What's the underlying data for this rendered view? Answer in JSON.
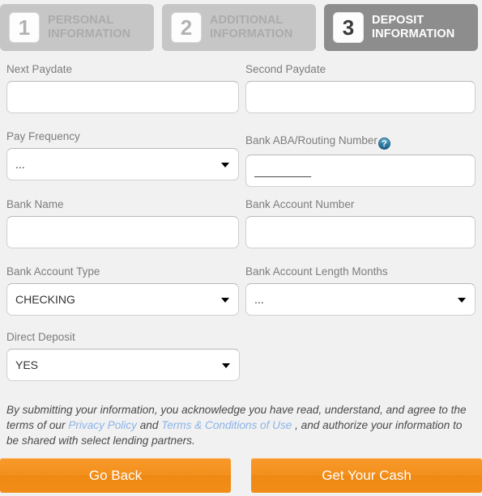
{
  "steps": [
    {
      "number": "1",
      "line1": "PERSONAL",
      "line2": "INFORMATION",
      "state": "inactive"
    },
    {
      "number": "2",
      "line1": "ADDITIONAL",
      "line2": "INFORMATION",
      "state": "inactive"
    },
    {
      "number": "3",
      "line1": "DEPOSIT",
      "line2": "INFORMATION",
      "state": "active"
    }
  ],
  "fields": {
    "next_paydate": {
      "label": "Next Paydate",
      "value": "",
      "placeholder": ""
    },
    "second_paydate": {
      "label": "Second Paydate",
      "value": "",
      "placeholder": ""
    },
    "pay_frequency": {
      "label": "Pay Frequency",
      "value": "..."
    },
    "bank_aba": {
      "label": "Bank ABA/Routing Number",
      "value": "_________",
      "help_icon": "?"
    },
    "bank_name": {
      "label": "Bank Name",
      "value": "",
      "placeholder": ""
    },
    "bank_account_number": {
      "label": "Bank Account Number",
      "value": "",
      "placeholder": ""
    },
    "bank_account_type": {
      "label": "Bank Account Type",
      "value": "CHECKING"
    },
    "bank_account_length": {
      "label": "Bank Account Length Months",
      "value": "..."
    },
    "direct_deposit": {
      "label": "Direct Deposit",
      "value": "YES"
    }
  },
  "disclaimer": {
    "part1": "By submitting your information, you acknowledge you have read, understand, and agree to the terms of our ",
    "link1": "Privacy Policy",
    "part2": " and ",
    "link2": "Terms & Conditions of Use",
    "part3": " , and authorize your information to be shared with select lending partners."
  },
  "buttons": {
    "back": "Go Back",
    "submit": "Get Your Cash"
  },
  "colors": {
    "accent": "#f4901c",
    "active_step": "#8d8d8d",
    "inactive_step": "#c6c6c6",
    "link": "#8bb3e8",
    "help_icon": "#2f7fa8"
  }
}
